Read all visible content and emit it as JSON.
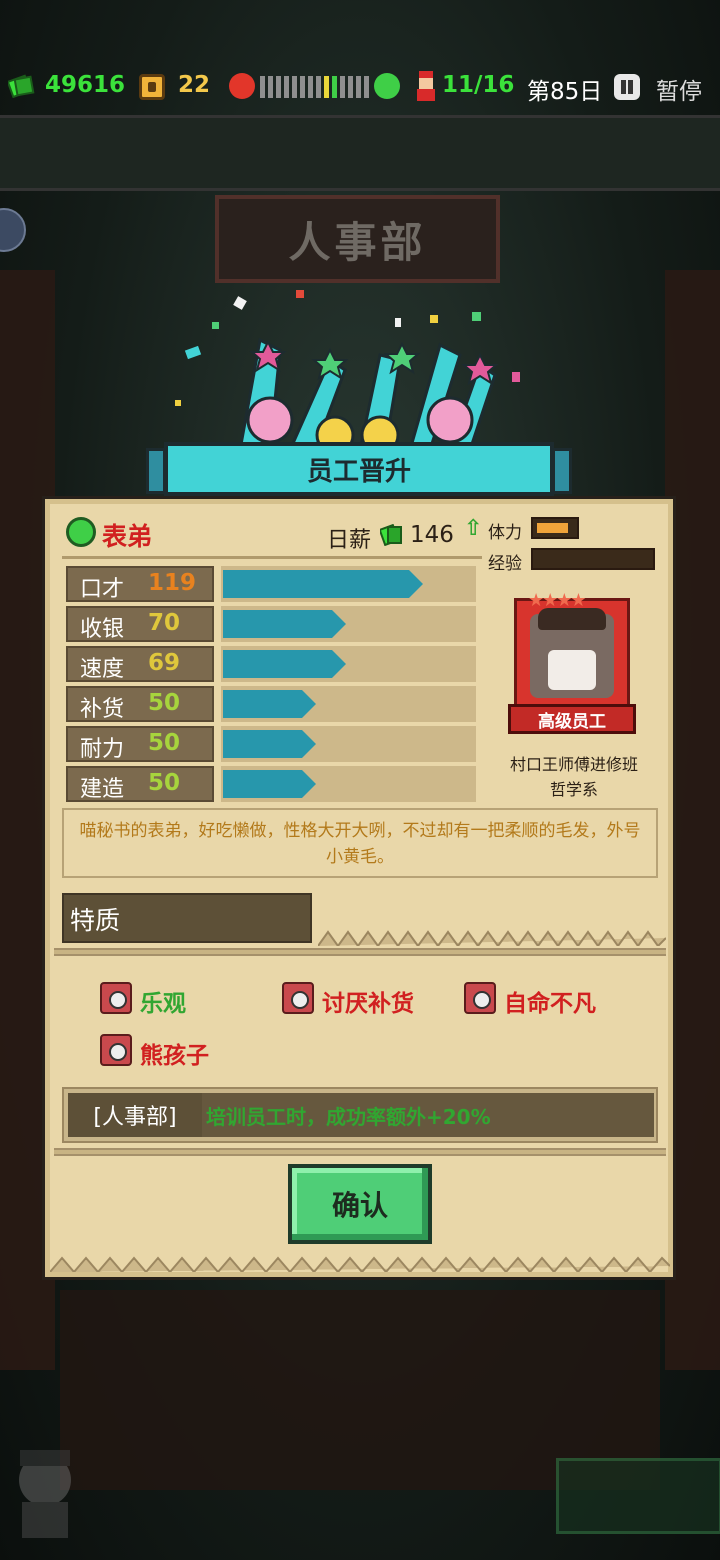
{
  "status_bar": {
    "money": "49616",
    "coins": "22",
    "staff": "11/16",
    "day": "第85日",
    "pause_label": "暂停",
    "colors": {
      "money": "#3be23b",
      "coins": "#f3c84b"
    }
  },
  "background": {
    "department_sign": "人事部"
  },
  "dialog": {
    "title": "员工晋升",
    "employee": {
      "name": "表弟",
      "salary_label": "日薪",
      "salary": "146",
      "stamina_label": "体力",
      "stamina_level": 0.85,
      "exp_label": "经验",
      "exp_level": 0.0,
      "rank": "高级员工",
      "stars": 4,
      "origin_line1": "村口王师傅进修班",
      "origin_line2": "哲学系"
    },
    "stats": [
      {
        "name": "口才",
        "value": "119",
        "color": "#e8821f",
        "fraction": 0.8
      },
      {
        "name": "收银",
        "value": "70",
        "color": "#dfc73c",
        "fraction": 0.49
      },
      {
        "name": "速度",
        "value": "69",
        "color": "#dfc73c",
        "fraction": 0.49
      },
      {
        "name": "补货",
        "value": "50",
        "color": "#a7d43d",
        "fraction": 0.37
      },
      {
        "name": "耐力",
        "value": "50",
        "color": "#a7d43d",
        "fraction": 0.37
      },
      {
        "name": "建造",
        "value": "50",
        "color": "#a7d43d",
        "fraction": 0.37
      }
    ],
    "description": "喵秘书的表弟，好吃懒做，性格大开大咧，不过却有一把柔顺的毛发，外号小黄毛。",
    "traits_header": "特质",
    "traits": [
      {
        "name": "乐观",
        "color": "#31a631"
      },
      {
        "name": "讨厌补货",
        "color": "#d12020"
      },
      {
        "name": "自命不凡",
        "color": "#d12020"
      },
      {
        "name": "熊孩子",
        "color": "#d12020"
      }
    ],
    "department_bonus": {
      "tag": "[人事部]",
      "text": "培训员工时，成功率额外+20%"
    },
    "confirm_label": "确认"
  }
}
